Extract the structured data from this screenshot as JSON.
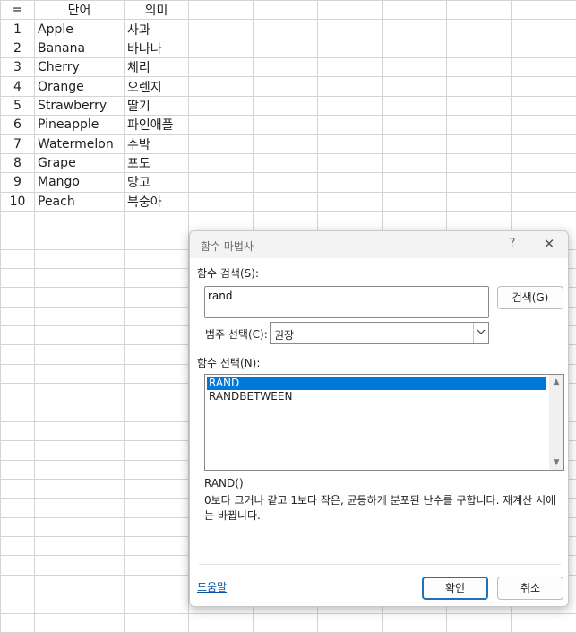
{
  "sheet": {
    "corner": "=",
    "headers": [
      "단어",
      "의미"
    ],
    "rows": [
      {
        "num": "1",
        "word": "Apple",
        "meaning": "사과"
      },
      {
        "num": "2",
        "word": "Banana",
        "meaning": "바나나"
      },
      {
        "num": "3",
        "word": "Cherry",
        "meaning": "체리"
      },
      {
        "num": "4",
        "word": "Orange",
        "meaning": "오렌지"
      },
      {
        "num": "5",
        "word": "Strawberry",
        "meaning": "딸기"
      },
      {
        "num": "6",
        "word": "Pineapple",
        "meaning": "파인애플"
      },
      {
        "num": "7",
        "word": "Watermelon",
        "meaning": "수박"
      },
      {
        "num": "8",
        "word": "Grape",
        "meaning": "포도"
      },
      {
        "num": "9",
        "word": "Mango",
        "meaning": "망고"
      },
      {
        "num": "10",
        "word": "Peach",
        "meaning": "복숭아"
      }
    ]
  },
  "dialog": {
    "title": "함수 마법사",
    "help_label": "?",
    "close_label": "✕",
    "search_label": "함수 검색(S):",
    "search_value": "rand",
    "search_button": "검색(G)",
    "category_label": "범주 선택(C):",
    "category_value": "권장",
    "function_list_label": "함수 선택(N):",
    "functions": [
      "RAND",
      "RANDBETWEEN"
    ],
    "selected_function": "RAND",
    "syntax": "RAND()",
    "description": "0보다 크거나 같고 1보다 작은, 균등하게 분포된 난수를 구합니다. 재계산 시에는 바뀝니다.",
    "help_link": "도움말",
    "ok_button": "확인",
    "cancel_button": "취소"
  },
  "icons": {
    "dropdown": "chevron-down-icon",
    "scroll_up": "scroll-up-arrow-icon",
    "scroll_down": "scroll-down-arrow-icon"
  }
}
